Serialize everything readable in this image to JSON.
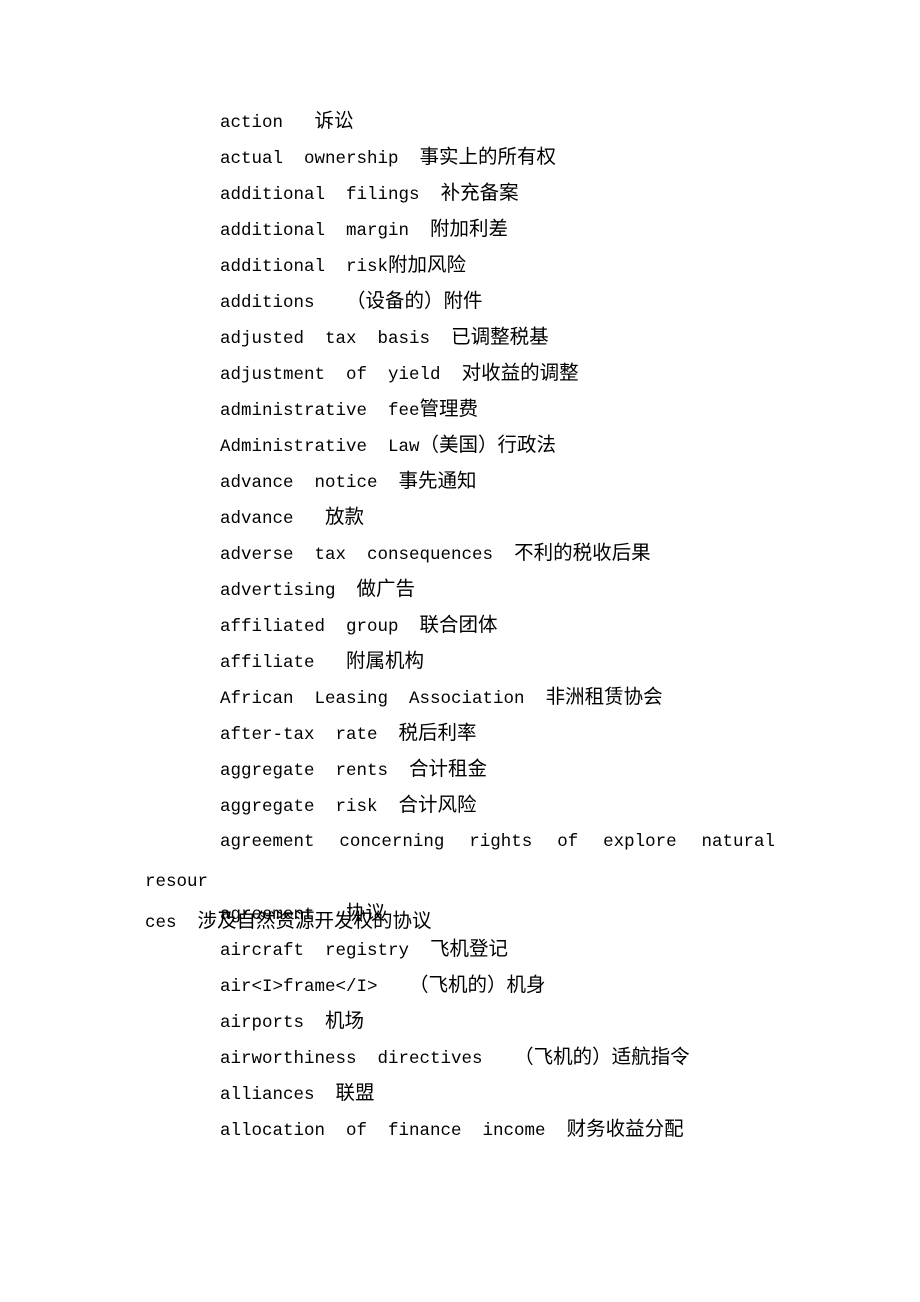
{
  "document": {
    "kind": "bilingual-glossary",
    "language_pair": "English-Chinese",
    "background_color": "#ffffff",
    "text_color": "#000000",
    "entries": [
      {
        "en": "action",
        "sep": "   ",
        "zh": "诉讼"
      },
      {
        "en": "actual  ownership",
        "sep": "  ",
        "zh": "事实上的所有权"
      },
      {
        "en": "additional  filings",
        "sep": "  ",
        "zh": "补充备案"
      },
      {
        "en": "additional  margin",
        "sep": "  ",
        "zh": "附加利差"
      },
      {
        "en": "additional  risk",
        "sep": "",
        "zh": "附加风险"
      },
      {
        "en": "additions",
        "sep": "   ",
        "zh": "（设备的）附件"
      },
      {
        "en": "adjusted  tax  basis",
        "sep": "  ",
        "zh": "已调整税基"
      },
      {
        "en": "adjustment  of  yield",
        "sep": "  ",
        "zh": "对收益的调整"
      },
      {
        "en": "administrative  fee",
        "sep": "",
        "zh": "管理费"
      },
      {
        "en": "Administrative  Law",
        "sep": "",
        "zh": "（美国）行政法"
      },
      {
        "en": "advance  notice",
        "sep": "  ",
        "zh": "事先通知"
      },
      {
        "en": "advance",
        "sep": "   ",
        "zh": "放款"
      },
      {
        "en": "adverse  tax  consequences",
        "sep": "  ",
        "zh": "不利的税收后果"
      },
      {
        "en": "advertising",
        "sep": "  ",
        "zh": "做广告"
      },
      {
        "en": "affiliated  group",
        "sep": "  ",
        "zh": "联合团体"
      },
      {
        "en": "affiliate",
        "sep": "   ",
        "zh": "附属机构"
      },
      {
        "en": "African  Leasing  Association",
        "sep": "  ",
        "zh": "非洲租赁协会"
      },
      {
        "en": "after-tax  rate",
        "sep": "  ",
        "zh": "税后利率"
      },
      {
        "en": "aggregate  rents",
        "sep": "  ",
        "zh": "合计租金"
      },
      {
        "en": "aggregate  risk",
        "sep": "  ",
        "zh": "合计风险"
      },
      {
        "en": "agreement  concerning  rights  of  explore  natural  resources",
        "sep": "  ",
        "zh": "涉及自然资源开发权的协议",
        "wrapped": true
      },
      {
        "en": "agreement",
        "sep": "   ",
        "zh": "协议"
      },
      {
        "en": "aircraft  registry",
        "sep": "  ",
        "zh": "飞机登记"
      },
      {
        "en": "air<I>frame</I>",
        "sep": "   ",
        "zh": "（飞机的）机身"
      },
      {
        "en": "airports",
        "sep": "  ",
        "zh": "机场"
      },
      {
        "en": "airworthiness  directives",
        "sep": "   ",
        "zh": "（飞机的）适航指令"
      },
      {
        "en": "alliances",
        "sep": "  ",
        "zh": "联盟"
      },
      {
        "en": "allocation  of  finance  income",
        "sep": "  ",
        "zh": "财务收益分配"
      }
    ],
    "wrapped_entry": {
      "line1_en": "agreement  concerning  rights  of  explore  natural  resour",
      "line2_en": "ces",
      "line2_sep": "  ",
      "line2_zh": "涉及自然资源开发权的协议"
    }
  }
}
